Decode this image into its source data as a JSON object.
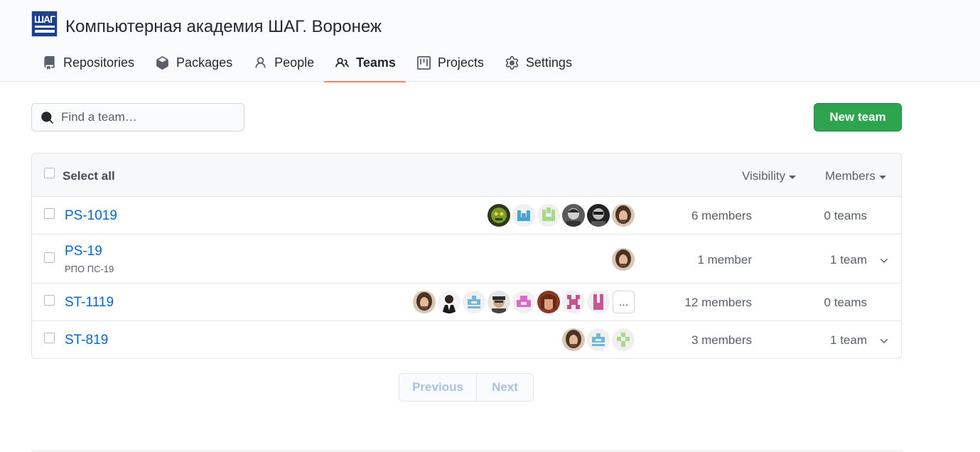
{
  "org": {
    "name": "Компьютерная академия ШАГ. Воронеж",
    "logo_text": "ШАГ"
  },
  "nav": [
    {
      "label": "Repositories",
      "icon": "repo-icon",
      "selected": false
    },
    {
      "label": "Packages",
      "icon": "package-icon",
      "selected": false
    },
    {
      "label": "People",
      "icon": "person-icon",
      "selected": false
    },
    {
      "label": "Teams",
      "icon": "people-icon",
      "selected": true
    },
    {
      "label": "Projects",
      "icon": "project-icon",
      "selected": false
    },
    {
      "label": "Settings",
      "icon": "gear-icon",
      "selected": false
    }
  ],
  "search": {
    "placeholder": "Find a team…",
    "value": ""
  },
  "new_team_label": "New team",
  "table": {
    "select_all": "Select all",
    "filters": [
      "Visibility",
      "Members"
    ],
    "teams": [
      {
        "name": "PS-1019",
        "description": "",
        "members": "6 members",
        "child_teams": "0 teams",
        "expandable": false,
        "avatars": [
          "photo-man-long-hair",
          "photo-sunglasses",
          "photo-dark-portrait",
          "identicon-green",
          "identicon-blue",
          "photo-green-mask"
        ],
        "more": ""
      },
      {
        "name": "PS-19",
        "description": "РПО ПС-19",
        "members": "1 member",
        "child_teams": "1 team",
        "expandable": true,
        "avatars": [
          "photo-man-long-hair"
        ],
        "more": ""
      },
      {
        "name": "ST-1119",
        "description": "",
        "members": "12 members",
        "child_teams": "0 teams",
        "expandable": false,
        "avatars": [
          "photo-man-long-hair",
          "photo-man-suit",
          "identicon-blue-2",
          "photo-man-cap",
          "identicon-pink",
          "photo-woman",
          "identicon-pink-2",
          "identicon-magenta"
        ],
        "more": "…"
      },
      {
        "name": "ST-819",
        "description": "",
        "members": "3 members",
        "child_teams": "1 team",
        "expandable": true,
        "avatars": [
          "photo-man-long-hair",
          "identicon-blue-2",
          "identicon-green-2"
        ],
        "more": ""
      }
    ]
  },
  "pagination": {
    "previous": "Previous",
    "next": "Next"
  },
  "colors": {
    "accent": "#f9826c",
    "link": "#0366d6",
    "primary_button": "#2ea44f"
  }
}
